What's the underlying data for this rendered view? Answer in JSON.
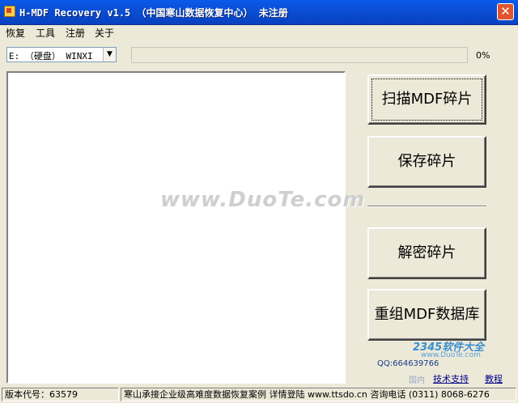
{
  "window": {
    "title": "H-MDF Recovery v1.5 （中国寒山数据恢复中心） 未注册",
    "close_glyph": "✕"
  },
  "menu": {
    "items": [
      {
        "label": "恢复"
      },
      {
        "label": "工具"
      },
      {
        "label": "注册"
      },
      {
        "label": "关于"
      }
    ]
  },
  "toolbar": {
    "drive_value": "E: （硬盘） WINXI",
    "progress_percent_label": "0%",
    "progress_value": 0
  },
  "buttons": {
    "scan": "扫描MDF碎片",
    "save": "保存碎片",
    "decrypt": "解密碎片",
    "rebuild": "重组MDF数据库"
  },
  "watermark": "www.DuoTe.com",
  "info": {
    "qq": "QQ:664639766",
    "support_link": "技术支持",
    "tutorial_link": "教程"
  },
  "overlay_logo": {
    "brand": "2345软件大全",
    "url": "www.DuoTe.com",
    "faint": "国内"
  },
  "statusbar": {
    "version": "版本代号：63579",
    "message": "寒山承接企业级高难度数据恢复案例 详情登陆 www.ttsdo.cn 咨询电话 (0311) 8068-6276"
  }
}
